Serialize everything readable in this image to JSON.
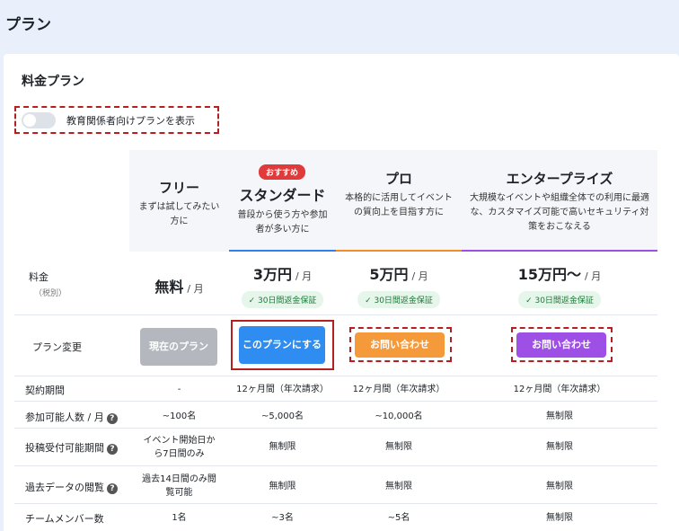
{
  "page": {
    "title": "プラン"
  },
  "section": {
    "title": "料金プラン"
  },
  "toggle": {
    "label": "教育関係者向けプランを表示"
  },
  "plans": [
    {
      "name": "フリー",
      "desc": "まずは試してみたい方に"
    },
    {
      "name": "スタンダード",
      "desc": "普段から使う方や参加者が多い方に",
      "badge": "おすすめ"
    },
    {
      "name": "プロ",
      "desc": "本格的に活用してイベントの質向上を目指す方に"
    },
    {
      "name": "エンタープライズ",
      "desc": "大規模なイベントや組織全体での利用に最適な、カスタマイズ可能で高いセキュリティ対策をおこなえる"
    }
  ],
  "price_row": {
    "label": "料金",
    "sub": "（税別）",
    "unit": "/ 月",
    "guarantee": "✓ 30日間返金保証",
    "values": [
      "無料",
      "3万円",
      "5万円",
      "15万円〜"
    ]
  },
  "plan_change_row": {
    "label": "プラン変更",
    "buttons": [
      "現在のプラン",
      "このプランにする",
      "お問い合わせ",
      "お問い合わせ"
    ]
  },
  "rows": [
    {
      "label": "契約期間",
      "values": [
        "-",
        "12ヶ月間（年次請求）",
        "12ヶ月間（年次請求）",
        "12ヶ月間（年次請求）"
      ]
    },
    {
      "label": "参加可能人数 / 月",
      "values": [
        "~100名",
        "~5,000名",
        "~10,000名",
        "無制限"
      ]
    },
    {
      "label": "投稿受付可能期間",
      "values": [
        "イベント開始日から7日間のみ",
        "無制限",
        "無制限",
        "無制限"
      ]
    },
    {
      "label": "過去データの閲覧",
      "values": [
        "過去14日間のみ閲覧可能",
        "無制限",
        "無制限",
        "無制限"
      ]
    },
    {
      "label": "チームメンバー数",
      "values": [
        "1名",
        "~3名",
        "~5名",
        "無制限"
      ]
    }
  ],
  "colors": {
    "standard": "#2f80ed",
    "pro": "#f08c2c",
    "enterprise": "#9b51e0",
    "free_button": "#b4b8be"
  }
}
